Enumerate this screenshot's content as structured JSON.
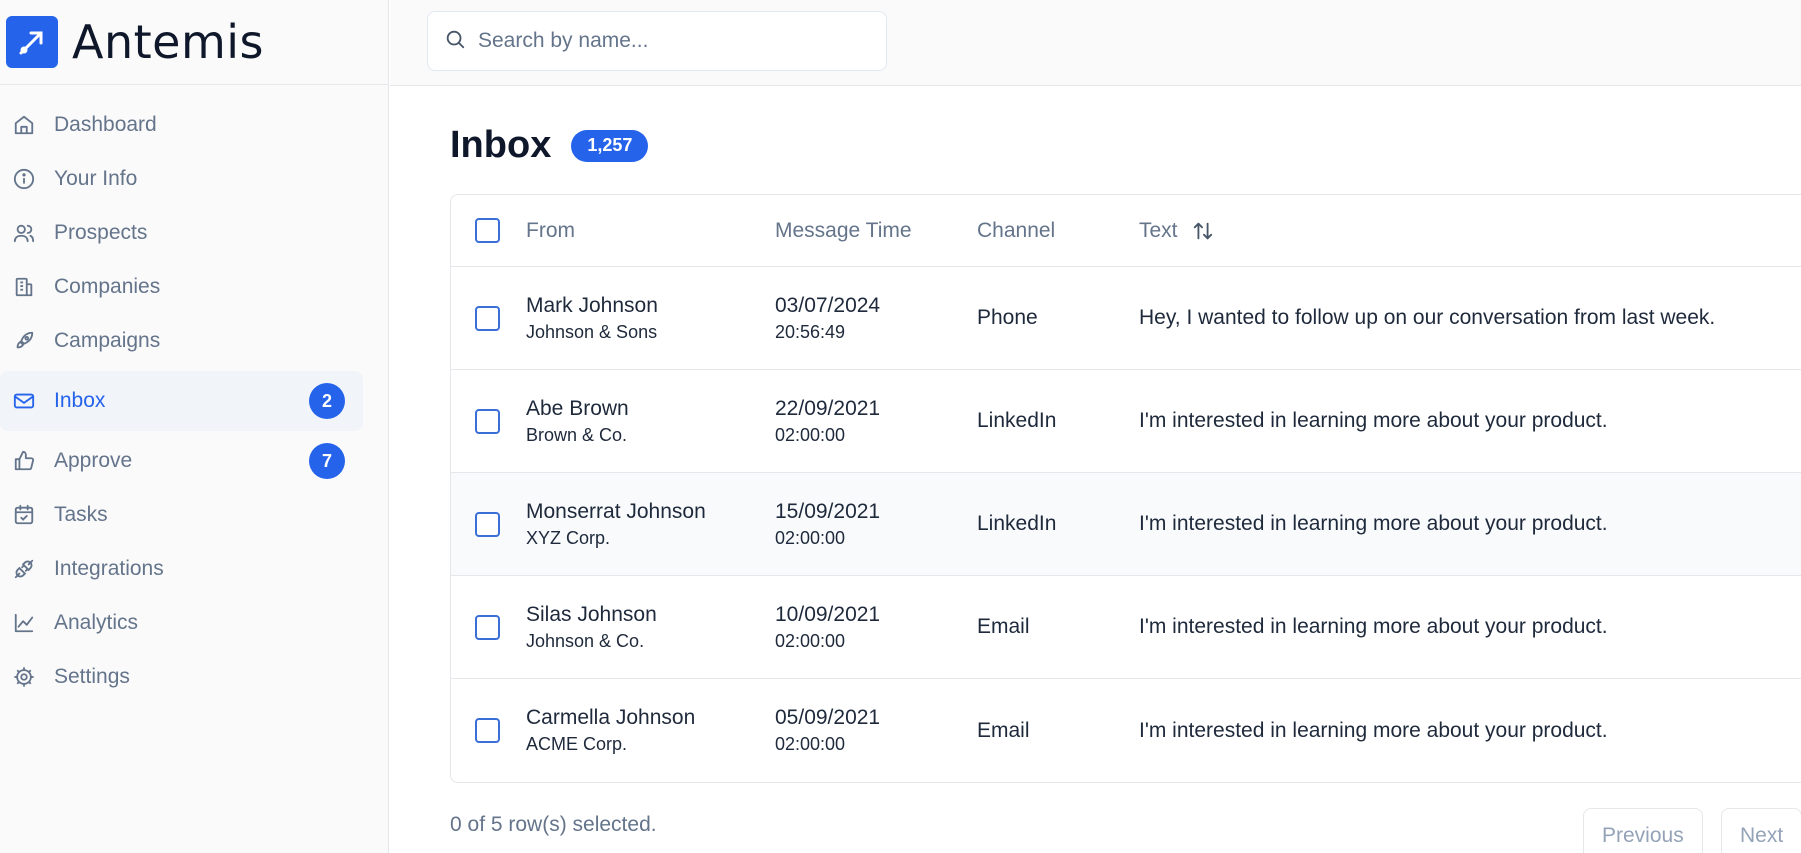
{
  "app": {
    "name": "Antemis"
  },
  "search": {
    "placeholder": "Search by name..."
  },
  "sidebar": {
    "items": [
      {
        "label": "Dashboard",
        "icon": "home-icon"
      },
      {
        "label": "Your Info",
        "icon": "info-icon"
      },
      {
        "label": "Prospects",
        "icon": "users-icon"
      },
      {
        "label": "Companies",
        "icon": "building-icon"
      },
      {
        "label": "Campaigns",
        "icon": "rocket-icon"
      },
      {
        "label": "Inbox",
        "icon": "mail-icon",
        "badge": "2",
        "active": true
      },
      {
        "label": "Approve",
        "icon": "thumbs-up-icon",
        "badge": "7"
      },
      {
        "label": "Tasks",
        "icon": "calendar-check-icon"
      },
      {
        "label": "Integrations",
        "icon": "plug-icon"
      },
      {
        "label": "Analytics",
        "icon": "line-chart-icon"
      },
      {
        "label": "Settings",
        "icon": "gear-icon"
      }
    ]
  },
  "main": {
    "title": "Inbox",
    "count": "1,257",
    "table": {
      "headers": {
        "from": "From",
        "time": "Message Time",
        "channel": "Channel",
        "text": "Text"
      },
      "rows": [
        {
          "name": "Mark Johnson",
          "company": "Johnson & Sons",
          "date": "03/07/2024",
          "time": "20:56:49",
          "channel": "Phone",
          "text": "Hey, I wanted to follow up on our conversation from last week."
        },
        {
          "name": "Abe Brown",
          "company": "Brown & Co.",
          "date": "22/09/2021",
          "time": "02:00:00",
          "channel": "LinkedIn",
          "text": "I'm interested in learning more about your product."
        },
        {
          "name": "Monserrat Johnson",
          "company": "XYZ Corp.",
          "date": "15/09/2021",
          "time": "02:00:00",
          "channel": "LinkedIn",
          "text": "I'm interested in learning more about your product."
        },
        {
          "name": "Silas Johnson",
          "company": "Johnson & Co.",
          "date": "10/09/2021",
          "time": "02:00:00",
          "channel": "Email",
          "text": "I'm interested in learning more about your product."
        },
        {
          "name": "Carmella Johnson",
          "company": "ACME Corp.",
          "date": "05/09/2021",
          "time": "02:00:00",
          "channel": "Email",
          "text": "I'm interested in learning more about your product."
        }
      ]
    },
    "footer": {
      "selection": "0 of 5 row(s) selected.",
      "previous": "Previous",
      "next": "Next"
    }
  },
  "colors": {
    "accent": "#2563eb",
    "muted_text": "#64748b",
    "border": "#e5e7eb"
  }
}
